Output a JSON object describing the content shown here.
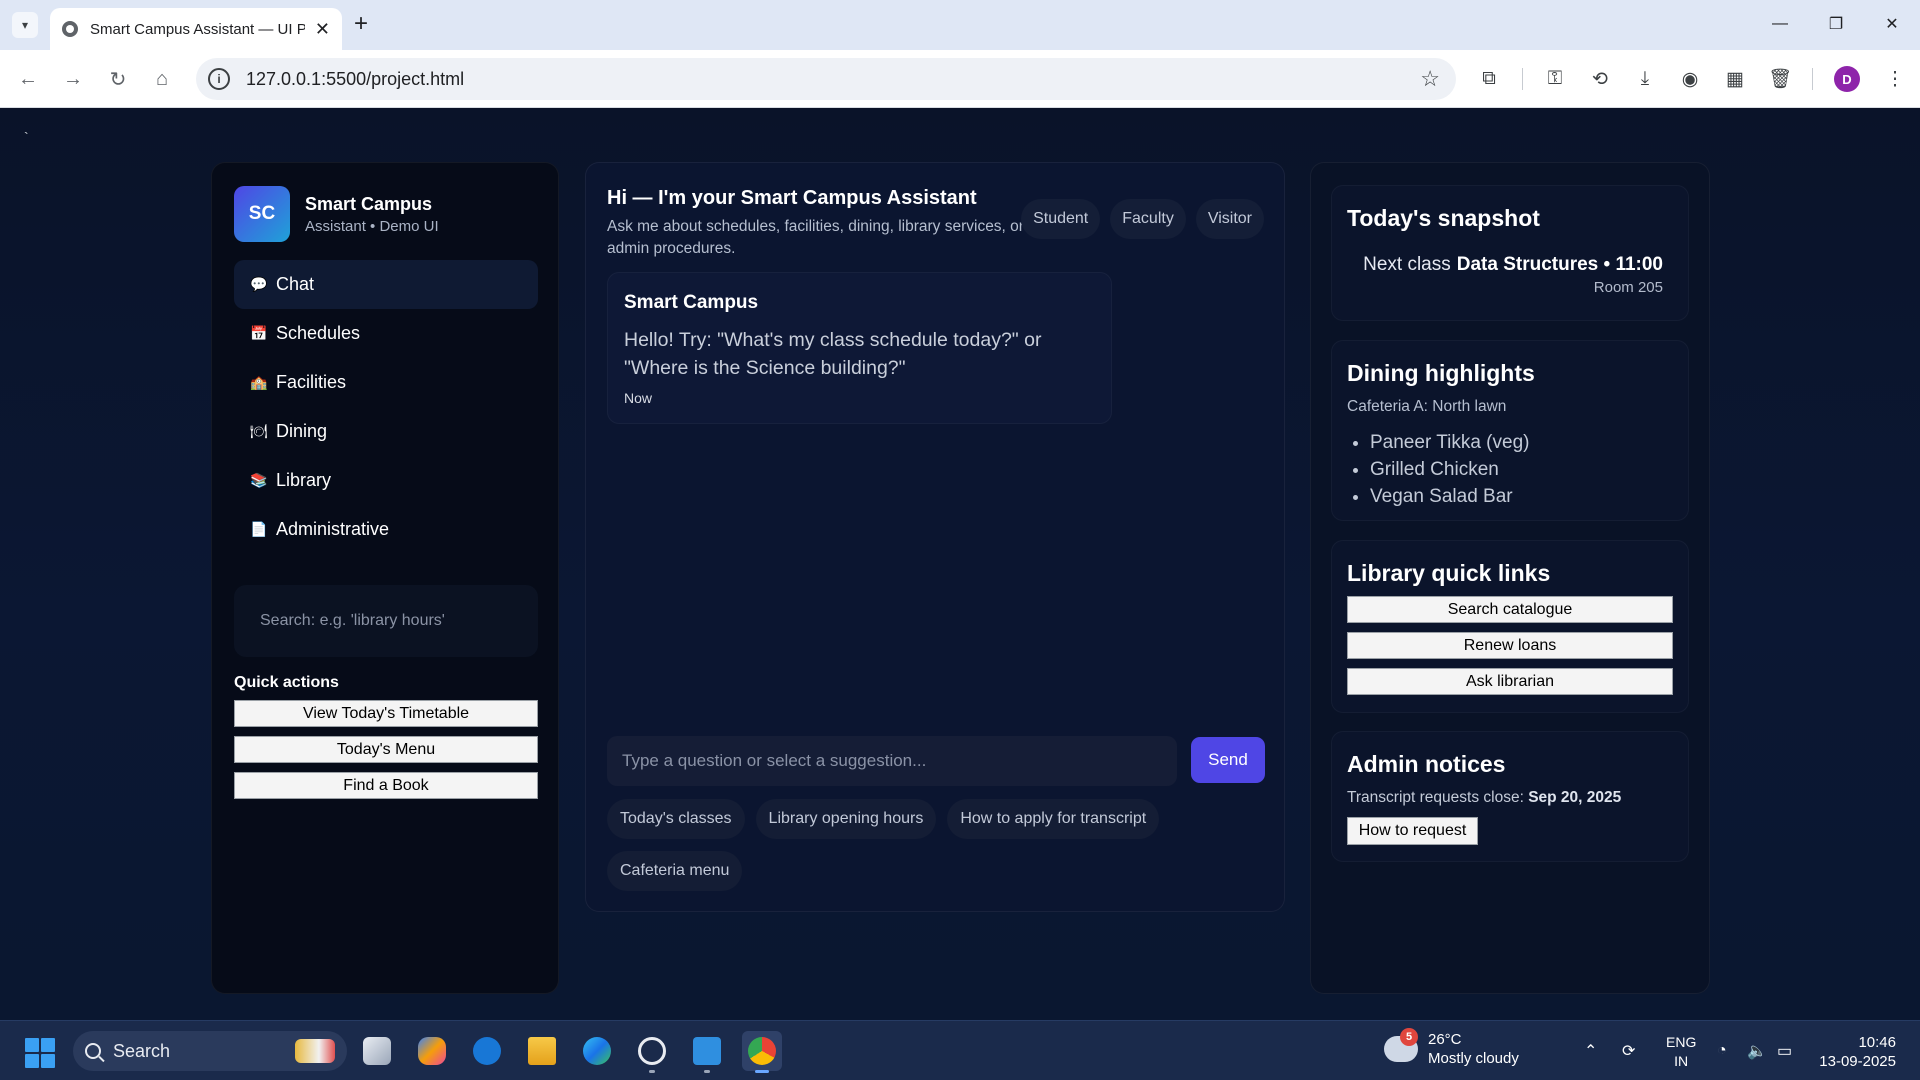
{
  "browser": {
    "tab_title": "Smart Campus Assistant — UI P",
    "url": "127.0.0.1:5500/project.html",
    "profile_initial": "D"
  },
  "page": {
    "stray_mark": "`"
  },
  "sidebar": {
    "logo": "SC",
    "brand_name": "Smart Campus",
    "brand_sub": "Assistant • Demo UI",
    "nav": [
      {
        "icon": "💬",
        "label": "Chat"
      },
      {
        "icon": "📅",
        "label": "Schedules"
      },
      {
        "icon": "🏫",
        "label": "Facilities"
      },
      {
        "icon": "🍽",
        "label": "Dining"
      },
      {
        "icon": "📚",
        "label": "Library"
      },
      {
        "icon": "📄",
        "label": "Administrative"
      }
    ],
    "search_placeholder": "Search: e.g. 'library hours'",
    "quick_actions_title": "Quick actions",
    "quick_actions": [
      "View Today's Timetable",
      "Today's Menu",
      "Find a Book"
    ]
  },
  "chat": {
    "title": "Hi — I'm your Smart Campus Assistant",
    "subtitle": "Ask me about schedules, facilities, dining, library services, or admin procedures.",
    "roles": [
      "Student",
      "Faculty",
      "Visitor"
    ],
    "message": {
      "sender": "Smart Campus",
      "text": "Hello! Try: \"What's my class schedule today?\" or \"Where is the Science building?\"",
      "time": "Now"
    },
    "input_placeholder": "Type a question or select a suggestion...",
    "send_label": "Send",
    "suggestions": [
      "Today's classes",
      "Library opening hours",
      "How to apply for transcript",
      "Cafeteria menu"
    ]
  },
  "snapshot": {
    "title": "Today's snapshot",
    "next_class_label": "Next class",
    "next_class_value": "Data Structures • 11:00",
    "room": "Room 205"
  },
  "dining": {
    "title": "Dining highlights",
    "location": "Cafeteria A: North lawn",
    "items": [
      "Paneer Tikka (veg)",
      "Grilled Chicken",
      "Vegan Salad Bar"
    ]
  },
  "library": {
    "title": "Library quick links",
    "links": [
      "Search catalogue",
      "Renew loans",
      "Ask librarian"
    ]
  },
  "admin": {
    "title": "Admin notices",
    "notice_text": "Transcript requests close:",
    "notice_date": "Sep 20, 2025",
    "button": "How to request"
  },
  "taskbar": {
    "search_label": "Search",
    "weather_badge": "5",
    "temperature": "26°C",
    "condition": "Mostly cloudy",
    "lang_top": "ENG",
    "lang_bottom": "IN",
    "time": "10:46",
    "date": "13-09-2025"
  }
}
